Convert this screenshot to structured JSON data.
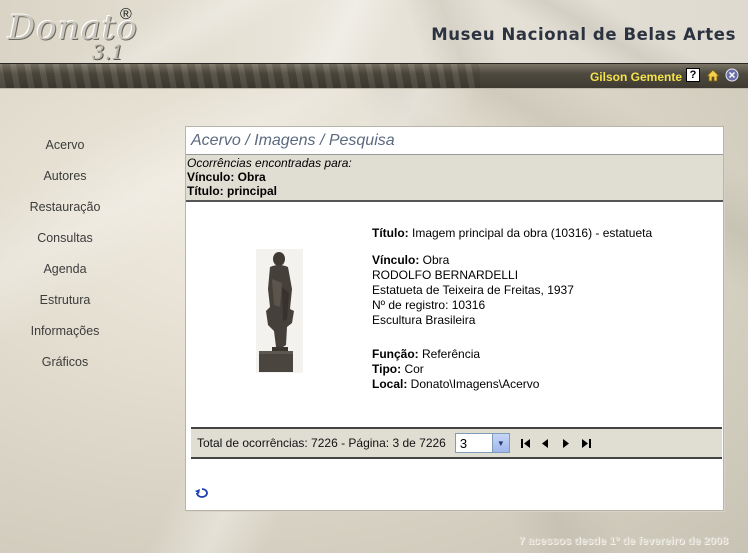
{
  "header": {
    "logo_text": "Donato",
    "logo_version": "3.1",
    "logo_registered": "®",
    "museum_title": "Museu Nacional de Belas Artes",
    "user_name": "Gilson Gemente",
    "icons": [
      "help-icon",
      "home-icon",
      "exit-icon"
    ]
  },
  "nav": {
    "items": [
      "Acervo",
      "Autores",
      "Restauração",
      "Consultas",
      "Agenda",
      "Estrutura",
      "Informações",
      "Gráficos"
    ]
  },
  "panel": {
    "title": "Acervo / Imagens / Pesquisa",
    "criteria": {
      "heading": "Ocorrências encontradas para:",
      "vinculo": "Vínculo: Obra",
      "titulo": "Título: principal"
    },
    "record": {
      "titulo_label": "Título:",
      "titulo_value": " Imagem principal da obra (10316) - estatueta",
      "vinculo_label": "Vínculo:",
      "vinculo_value": " Obra",
      "author": "RODOLFO BERNARDELLI",
      "work": "Estatueta de Teixeira de Freitas, 1937",
      "registro": "Nº de registro: 10316",
      "collection": "Escultura Brasileira",
      "funcao_label": "Função:",
      "funcao_value": " Referência",
      "tipo_label": "Tipo:",
      "tipo_value": " Cor",
      "local_label": "Local:",
      "local_value": " Donato\\Imagens\\Acervo"
    },
    "pager": {
      "summary": "Total de ocorrências: 7226 - Página: 3 de 7226",
      "page_select_value": "3",
      "buttons": [
        "first-page-icon",
        "prev-page-icon",
        "next-page-icon",
        "last-page-icon"
      ]
    }
  },
  "footer": {
    "text": "7 acessos desde 1º de fevereiro de 2008"
  },
  "colors": {
    "user_name": "#f4e24a",
    "title_text": "#5b6a7e",
    "band_background": "#4e4a3f"
  }
}
